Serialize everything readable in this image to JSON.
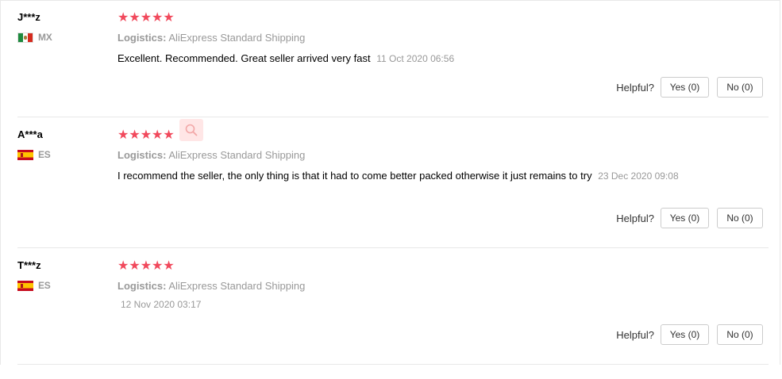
{
  "colors": {
    "star": "#f1495c",
    "muted": "#999999",
    "separator": "#e8e8e8",
    "button_border": "#cccccc"
  },
  "reviews": [
    {
      "user": "J***z",
      "country_code": "MX",
      "flag_icon": "mexico-flag",
      "rating": 5,
      "stars_text": "★★★★★",
      "logistics_label": "Logistics:",
      "logistics_value": "AliExpress Standard Shipping",
      "feedback": "Excellent. Recommended. Great seller arrived very fast",
      "date": "11 Oct 2020 06:56",
      "helpful_label": "Helpful?",
      "yes_label": "Yes (0)",
      "no_label": "No (0)"
    },
    {
      "user": "A***a",
      "country_code": "ES",
      "flag_icon": "spain-flag",
      "rating": 5,
      "stars_text": "★★★★★",
      "logistics_label": "Logistics:",
      "logistics_value": "AliExpress Standard Shipping",
      "feedback": "I recommend the seller, the only thing is that it had to come better packed otherwise it just remains to try",
      "date": "23 Dec 2020 09:08",
      "helpful_label": "Helpful?",
      "yes_label": "Yes (0)",
      "no_label": "No (0)"
    },
    {
      "user": "T***z",
      "country_code": "ES",
      "flag_icon": "spain-flag",
      "rating": 5,
      "stars_text": "★★★★★",
      "logistics_label": "Logistics:",
      "logistics_value": "AliExpress Standard Shipping",
      "feedback": "",
      "date": "12 Nov 2020 03:17",
      "helpful_label": "Helpful?",
      "yes_label": "Yes (0)",
      "no_label": "No (0)"
    }
  ],
  "overlay": {
    "icon": "search-icon"
  }
}
